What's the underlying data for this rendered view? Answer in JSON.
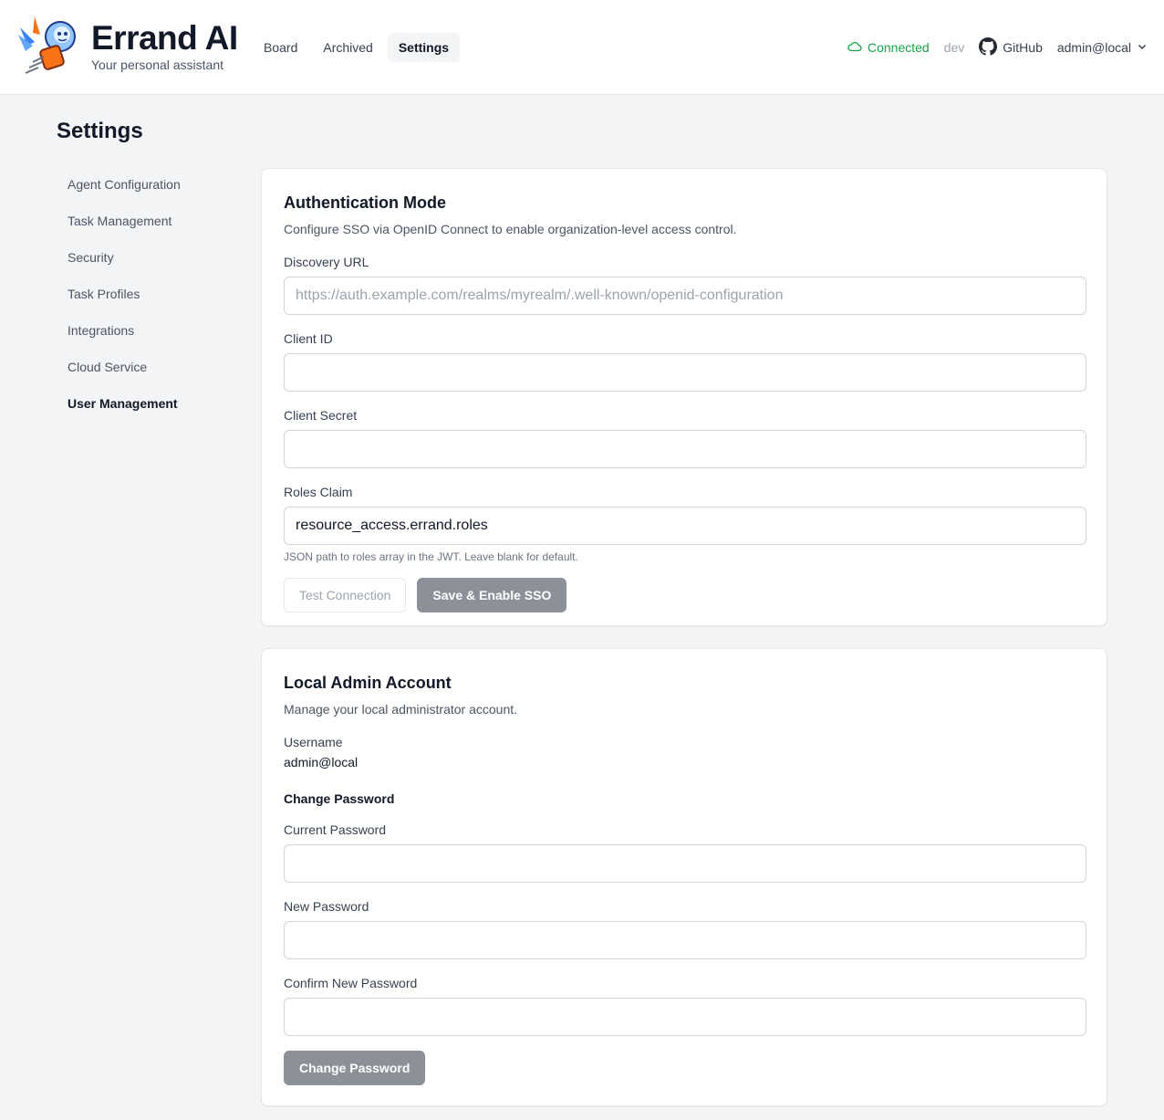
{
  "brand": {
    "title": "Errand AI",
    "subtitle": "Your personal assistant"
  },
  "nav": {
    "items": [
      "Board",
      "Archived",
      "Settings"
    ],
    "active": "Settings"
  },
  "status": {
    "connection": "Connected",
    "environment": "dev",
    "github": "GitHub",
    "user": "admin@local"
  },
  "colors": {
    "connected": "#16a34a",
    "disabled_button": "#8b9099"
  },
  "page": {
    "title": "Settings"
  },
  "sidebar": {
    "items": [
      {
        "label": "Agent Configuration"
      },
      {
        "label": "Task Management"
      },
      {
        "label": "Security"
      },
      {
        "label": "Task Profiles"
      },
      {
        "label": "Integrations"
      },
      {
        "label": "Cloud Service"
      },
      {
        "label": "User Management"
      }
    ],
    "active": "User Management"
  },
  "auth": {
    "title": "Authentication Mode",
    "description": "Configure SSO via OpenID Connect to enable organization-level access control.",
    "discovery_label": "Discovery URL",
    "discovery_placeholder": "https://auth.example.com/realms/myrealm/.well-known/openid-configuration",
    "discovery_value": "",
    "client_id_label": "Client ID",
    "client_id_value": "",
    "client_secret_label": "Client Secret",
    "client_secret_value": "",
    "roles_label": "Roles Claim",
    "roles_value": "resource_access.errand.roles",
    "roles_hint": "JSON path to roles array in the JWT. Leave blank for default.",
    "test_button": "Test Connection",
    "save_button": "Save & Enable SSO"
  },
  "admin": {
    "title": "Local Admin Account",
    "description": "Manage your local administrator account.",
    "username_label": "Username",
    "username_value": "admin@local",
    "change_heading": "Change Password",
    "current_label": "Current Password",
    "new_label": "New Password",
    "confirm_label": "Confirm New Password",
    "change_button": "Change Password"
  }
}
